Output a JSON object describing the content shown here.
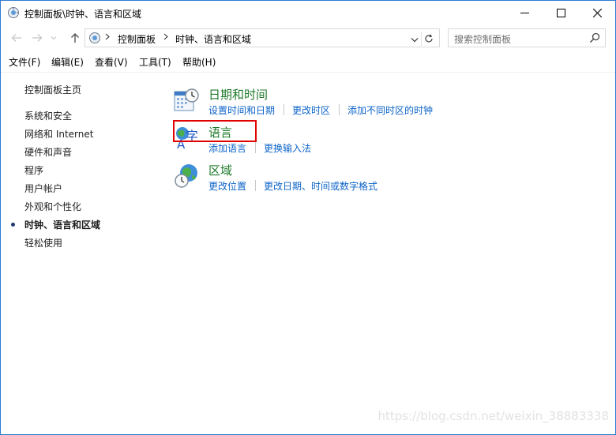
{
  "window": {
    "title": "控制面板\\时钟、语言和区域"
  },
  "address": {
    "crumbs": [
      "控制面板",
      "时钟、语言和区域"
    ]
  },
  "search": {
    "placeholder": "搜索控制面板"
  },
  "menu": [
    "文件(F)",
    "编辑(E)",
    "查看(V)",
    "工具(T)",
    "帮助(H)"
  ],
  "sidebar": {
    "home": "控制面板主页",
    "items": [
      {
        "label": "系统和安全"
      },
      {
        "label": "网络和 Internet"
      },
      {
        "label": "硬件和声音"
      },
      {
        "label": "程序"
      },
      {
        "label": "用户帐户"
      },
      {
        "label": "外观和个性化"
      },
      {
        "label": "时钟、语言和区域",
        "active": true
      },
      {
        "label": "轻松使用"
      }
    ]
  },
  "categories": [
    {
      "title": "日期和时间",
      "icon": "calendar-clock-icon",
      "links": [
        "设置时间和日期",
        "更改时区",
        "添加不同时区的时钟"
      ]
    },
    {
      "title": "语言",
      "icon": "language-icon",
      "links": [
        "添加语言",
        "更换输入法"
      ]
    },
    {
      "title": "区域",
      "icon": "globe-clock-icon",
      "links": [
        "更改位置",
        "更改日期、时间或数字格式"
      ]
    }
  ],
  "watermark": "https://blog.csdn.net/weixin_38883338",
  "colors": {
    "link": "#0c63c9",
    "category_title": "#1e7a2a",
    "highlight": "#e00000",
    "window_border": "#2b7bd1"
  }
}
